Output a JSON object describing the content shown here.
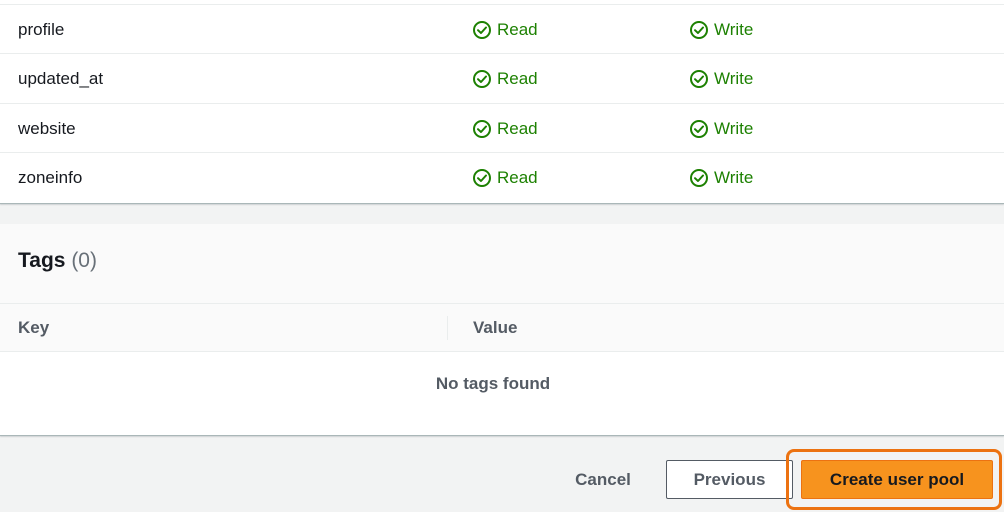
{
  "attributes": {
    "rows": [
      {
        "name": "profile",
        "read": "Read",
        "write": "Write"
      },
      {
        "name": "updated_at",
        "read": "Read",
        "write": "Write"
      },
      {
        "name": "website",
        "read": "Read",
        "write": "Write"
      },
      {
        "name": "zoneinfo",
        "read": "Read",
        "write": "Write"
      }
    ],
    "check_icon": "check-circle-icon",
    "permission_color": "#1d8102"
  },
  "tags": {
    "title": "Tags",
    "count": "(0)",
    "columns": {
      "key": "Key",
      "value": "Value"
    },
    "empty_message": "No tags found"
  },
  "footer": {
    "cancel_label": "Cancel",
    "previous_label": "Previous",
    "create_label": "Create user pool",
    "accent_color": "#ec7211"
  }
}
